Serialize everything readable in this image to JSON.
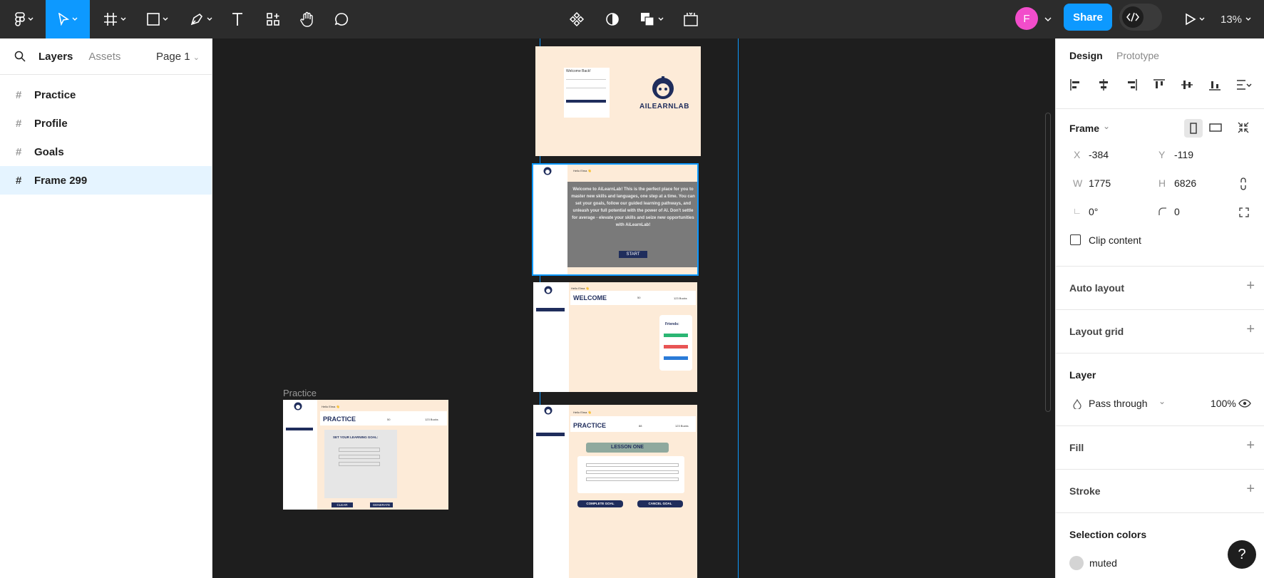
{
  "toolbar": {
    "share_label": "Share",
    "avatar_letter": "F",
    "zoom": "13%"
  },
  "left_panel": {
    "layers_tab": "Layers",
    "assets_tab": "Assets",
    "page": "Page 1",
    "layers": [
      {
        "label": "Practice"
      },
      {
        "label": "Profile"
      },
      {
        "label": "Goals"
      },
      {
        "label": "Frame 299"
      }
    ]
  },
  "canvas": {
    "practice_label": "Practice",
    "frame1": {
      "welcome": "Welcome Back!",
      "brand": "AILEARNLAB"
    },
    "frame2": {
      "welcome_text": "Welcome to AiLearnLab! This is the perfect place for you to master new skills and languages, one step at a time. You can set your goals, follow our guided learning pathways, and unleash your full potential with the power of AI. Don't settle for average - elevate your skills and seize new opportunities with AiLearnLab!",
      "start": "START",
      "hello": "Hello Elma 👋"
    },
    "frame3": {
      "title": "WELCOME",
      "friends": "Friends:",
      "score1": "50",
      "score2": "123 Bucks",
      "hello": "Hello Elma 👋"
    },
    "frame4": {
      "title": "PRACTICE",
      "goal": "SET YOUR LEARNING GOAL:",
      "clear": "CLEAR",
      "generate": "GENERATE",
      "score1": "50",
      "score2": "123 Bucks",
      "hello": "Hello Elma 👋"
    },
    "frame5": {
      "title": "PRACTICE",
      "lesson": "LESSON ONE",
      "complete": "COMPLETE GOAL",
      "cancel": "CANCEL GOAL",
      "score1": "88",
      "score2": "123 Bucks",
      "hello": "Hello Elma 👋"
    }
  },
  "right_panel": {
    "design_tab": "Design",
    "prototype_tab": "Prototype",
    "frame_label": "Frame",
    "x_label": "X",
    "x_value": "-384",
    "y_label": "Y",
    "y_value": "-119",
    "w_label": "W",
    "w_value": "1775",
    "h_label": "H",
    "h_value": "6826",
    "rotation": "0°",
    "radius": "0",
    "clip_content": "Clip content",
    "auto_layout": "Auto layout",
    "layout_grid": "Layout grid",
    "layer": "Layer",
    "blend": "Pass through",
    "opacity": "100%",
    "fill": "Fill",
    "stroke": "Stroke",
    "selection_colors": "Selection colors",
    "color_name": "muted"
  },
  "colors": {
    "accent": "#0d99ff",
    "frame_bg": "#fdebd8",
    "navy": "#1f2d5c"
  }
}
